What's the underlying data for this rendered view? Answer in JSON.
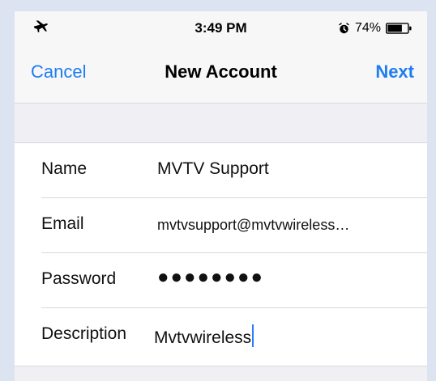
{
  "status_bar": {
    "time": "3:49 PM",
    "battery": "74%",
    "icons": {
      "left": "airplane-icon",
      "alarm": "alarm-icon",
      "battery": "battery-icon"
    }
  },
  "navigation": {
    "cancel_label": "Cancel",
    "title": "New Account",
    "next_label": "Next"
  },
  "form": {
    "rows": [
      {
        "label": "Name",
        "value": "MVTV Support"
      },
      {
        "label": "Email",
        "value": "mvtvsupport@mvtvwireless…"
      },
      {
        "label": "Password",
        "value": "●●●●●●●●"
      },
      {
        "label": "Description",
        "value": "Mvtvwireless"
      }
    ]
  },
  "colors": {
    "accent": "#1e7df0",
    "outer_background": "#dbe4f0",
    "screen_background": "#efeff4",
    "card_background": "#ffffff"
  }
}
